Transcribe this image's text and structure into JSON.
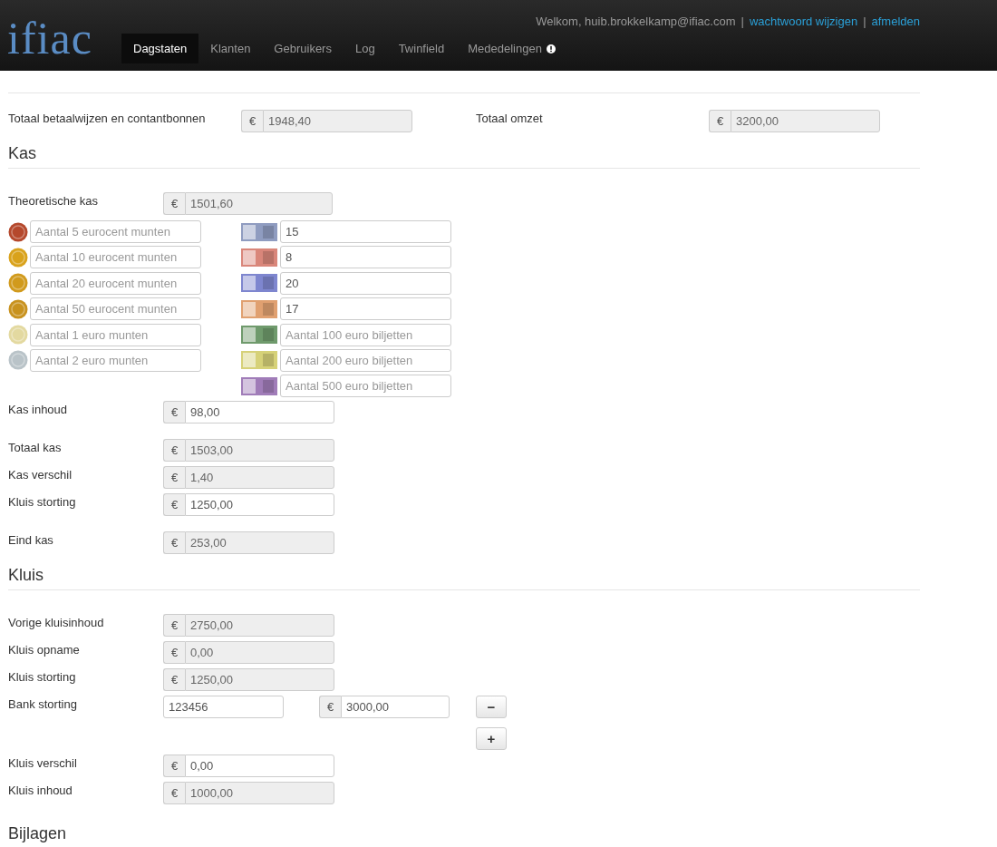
{
  "navbar": {
    "logo": "ifiac",
    "welcome": "Welkom, huib.brokkelkamp@ifiac.com",
    "separators": [
      "|",
      "|"
    ],
    "links": [
      "wachtwoord wijzigen",
      "afmelden"
    ],
    "tabs": [
      {
        "label": "Dagstaten",
        "selected": true,
        "alert": false
      },
      {
        "label": "Klanten",
        "selected": false,
        "alert": false
      },
      {
        "label": "Gebruikers",
        "selected": false,
        "alert": false
      },
      {
        "label": "Log",
        "selected": false,
        "alert": false
      },
      {
        "label": "Twinfield",
        "selected": false,
        "alert": false
      },
      {
        "label": "Mededelingen",
        "selected": false,
        "alert": true
      }
    ]
  },
  "summary": [
    {
      "label": "Totaal betaalwijzen en contantbonnen",
      "currency": "€",
      "value": "1948,40",
      "readonly": true
    },
    {
      "label": "Totaal omzet",
      "currency": "€",
      "value": "3200,00",
      "readonly": true
    }
  ],
  "kas": {
    "heading": "Kas",
    "theoretical": {
      "label": "Theoretische kas",
      "currency": "€",
      "value": "1501,60",
      "readonly": true
    },
    "coins": [
      {
        "placeholder": "Aantal 5 eurocent munten",
        "color": "#b5482c"
      },
      {
        "placeholder": "Aantal 10 eurocent munten",
        "color": "#d9a21b"
      },
      {
        "placeholder": "Aantal 20 eurocent munten",
        "color": "#d19a1c"
      },
      {
        "placeholder": "Aantal 50 eurocent munten",
        "color": "#c8921e"
      },
      {
        "placeholder": "Aantal 1 euro munten",
        "color": "#e3d9a0"
      },
      {
        "placeholder": "Aantal 2 euro munten",
        "color": "#b9c3c8"
      }
    ],
    "notes": [
      {
        "value": "15",
        "color": "#8f9cc0"
      },
      {
        "value": "8",
        "color": "#d9867a"
      },
      {
        "value": "20",
        "color": "#7e86cf"
      },
      {
        "value": "17",
        "color": "#e0a070"
      },
      {
        "placeholder": "Aantal 100 euro biljetten",
        "color": "#6f9a6c"
      },
      {
        "placeholder": "Aantal 200 euro biljetten",
        "color": "#d6d178"
      },
      {
        "placeholder": "Aantal 500 euro biljetten",
        "color": "#a07cb8"
      }
    ],
    "groups": [
      [
        {
          "label": "Kas inhoud",
          "currency": "€",
          "value": "98,00",
          "readonly": false
        }
      ],
      [
        {
          "label": "Totaal kas",
          "currency": "€",
          "value": "1503,00",
          "readonly": true
        },
        {
          "label": "Kas verschil",
          "currency": "€",
          "value": "1,40",
          "readonly": true
        },
        {
          "label": "Kluis storting",
          "currency": "€",
          "value": "1250,00",
          "readonly": false
        }
      ],
      [
        {
          "label": "Eind kas",
          "currency": "€",
          "value": "253,00",
          "readonly": true
        }
      ]
    ]
  },
  "kluis": {
    "heading": "Kluis",
    "groups": [
      [
        {
          "kind": "money",
          "label": "Vorige kluisinhoud",
          "currency": "€",
          "value": "2750,00",
          "readonly": true
        },
        {
          "kind": "money",
          "label": "Kluis opname",
          "currency": "€",
          "value": "0,00",
          "readonly": true
        },
        {
          "kind": "money",
          "label": "Kluis storting",
          "currency": "€",
          "value": "1250,00",
          "readonly": true
        },
        {
          "kind": "bank",
          "label": "Bank storting",
          "account": "123456",
          "currency": "€",
          "value": "3000,00",
          "readonly": false,
          "remove_button": "−",
          "add_button": "+"
        },
        {
          "kind": "money",
          "label": "Kluis verschil",
          "currency": "€",
          "value": "0,00",
          "readonly": false
        },
        {
          "kind": "money",
          "label": "Kluis inhoud",
          "currency": "€",
          "value": "1000,00",
          "readonly": true
        }
      ]
    ]
  },
  "bijlagen": {
    "heading": "Bijlagen"
  }
}
